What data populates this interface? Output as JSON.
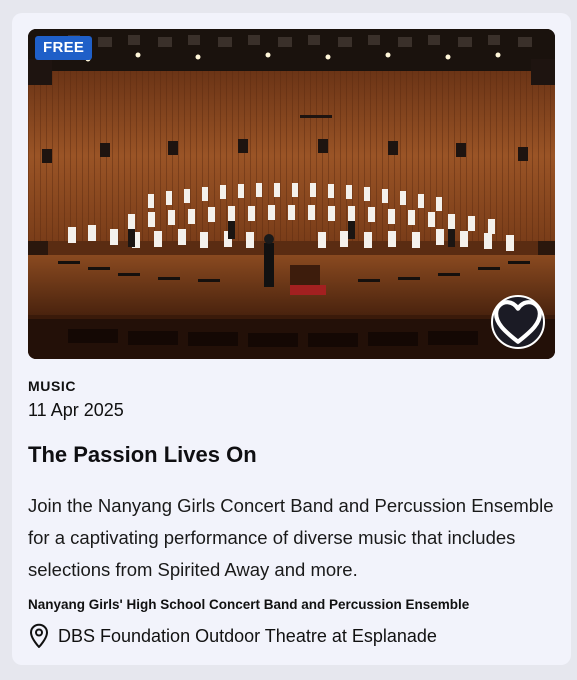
{
  "event": {
    "badge": "FREE",
    "image_alt": "Concert band on stage in a wood-panelled concert hall",
    "favourite_icon": "heart-icon",
    "category": "MUSIC",
    "date": "11 Apr 2025",
    "title": "The Passion Lives On",
    "description": "Join the Nanyang Girls Concert Band and Percussion Ensemble for a captivating performance of diverse music that includes selections from Spirited Away and more.",
    "organiser": "Nanyang Girls' High School Concert Band and Percussion Ensemble",
    "venue": "DBS Foundation Outdoor Theatre at Esplanade",
    "venue_icon": "location-pin-icon"
  },
  "colors": {
    "page_background": "#e6e7ee",
    "card_background": "#f2f3fb",
    "badge_background": "#1f5fc8",
    "favourite_button_background": "#1b1b25"
  }
}
